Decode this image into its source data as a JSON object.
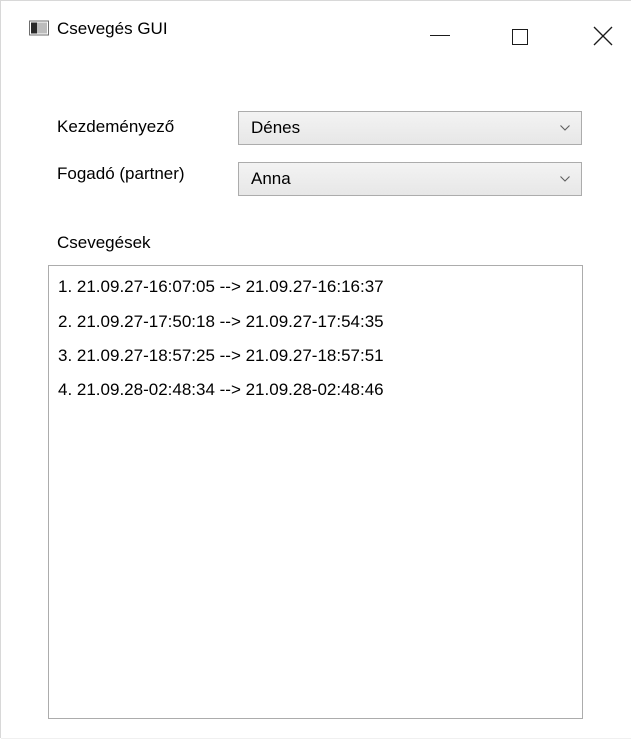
{
  "window": {
    "title": "Csevegés GUI"
  },
  "form": {
    "initiator_label": "Kezdeményező",
    "initiator_value": "Dénes",
    "receiver_label": "Fogadó (partner)",
    "receiver_value": "Anna",
    "chats_label": "Csevegések"
  },
  "chats": [
    "1. 21.09.27-16:07:05 --> 21.09.27-16:16:37",
    "2. 21.09.27-17:50:18 --> 21.09.27-17:54:35",
    "3. 21.09.27-18:57:25 --> 21.09.27-18:57:51",
    "4. 21.09.28-02:48:34 --> 21.09.28-02:48:46"
  ],
  "icons": {
    "app": "app-window-icon",
    "minimize": "minimize-icon",
    "maximize": "maximize-icon",
    "close": "close-icon",
    "dropdown": "chevron-down-icon"
  },
  "colors": {
    "combo_border": "#acacac",
    "combo_bg": "#e9e9e9",
    "text": "#000000"
  }
}
